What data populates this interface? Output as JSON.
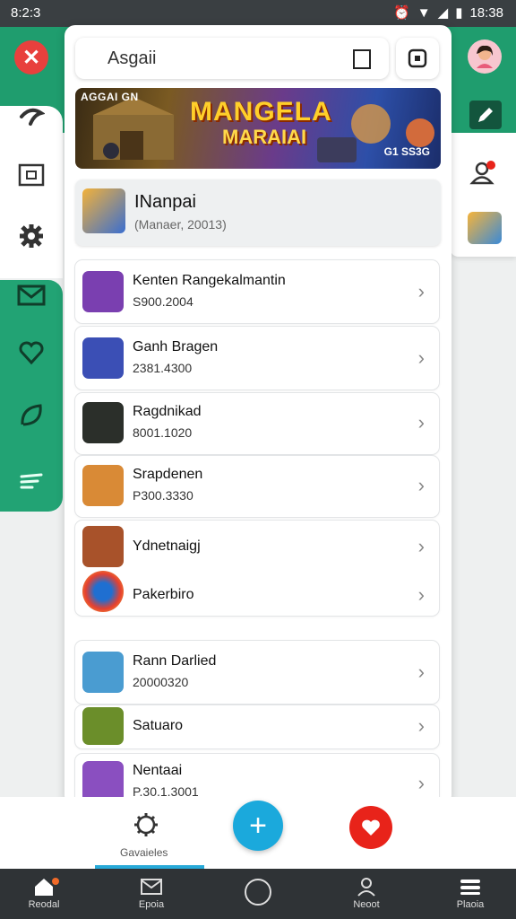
{
  "status_bar": {
    "time": "8:2:3",
    "clock": "18:38"
  },
  "search": {
    "value": "Asgaii"
  },
  "banner": {
    "subtitle": "AGGAI GN",
    "title_line1": "MANGELA",
    "title_line2": "MARAIAI",
    "price": "G1 SS3G"
  },
  "featured": {
    "title": "INanpai",
    "subtitle": "(Manaer, 20013)"
  },
  "apps": [
    {
      "name": "Kenten Rangekalmantin",
      "meta": "S900.2004",
      "icon_color": "#7a3fb0"
    },
    {
      "name": "Ganh Bragen",
      "meta": "2381.4300",
      "icon_color": "#3b4fb5"
    },
    {
      "name": "Ragdnikad",
      "meta": "8001.1020",
      "icon_color": "#2b2f2a"
    },
    {
      "name": "Srapdenen",
      "meta": "P300.3330",
      "icon_color": "#d98a36"
    },
    {
      "name": "Ydnetnaigj",
      "meta": "",
      "icon_color": "#a8522a"
    },
    {
      "name": "Pakerbiro",
      "meta": "",
      "icon_color": "#e6402f"
    },
    {
      "name": "Rann Darlied",
      "meta": "20000320",
      "icon_color": "#4a9cd1"
    },
    {
      "name": "Satuaro",
      "meta": "",
      "icon_color": "#6b8e2a"
    },
    {
      "name": "Nentaai",
      "meta": "P.30.1.3001",
      "icon_color": "#8a4fc0"
    }
  ],
  "action_bar": {
    "label": "Gavaieles"
  },
  "nav": {
    "home": "Reodal",
    "mail": "Epoia",
    "profile": "Neoot",
    "menu": "Plaoia"
  },
  "colors": {
    "accent_green": "#1f9d6e",
    "fab_blue": "#1ba9dc",
    "red": "#e8231a"
  }
}
